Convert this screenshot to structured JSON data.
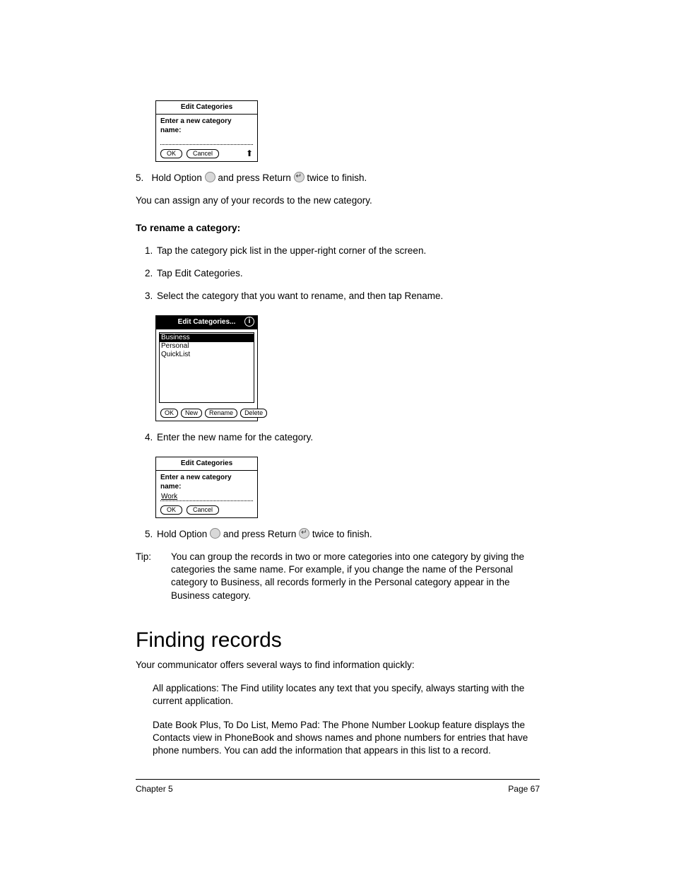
{
  "dialog1": {
    "title": "Edit Categories",
    "prompt": "Enter a new category name:",
    "input_value": "",
    "ok": "OK",
    "cancel": "Cancel"
  },
  "step5a": {
    "num": "5.",
    "pre": "Hold Option ",
    "mid": " and press Return ",
    "post": " twice to finish."
  },
  "assign_para": "You can assign any of your records to the new category.",
  "rename_head": "To rename a category:",
  "rename_steps": {
    "s1": "Tap the category pick list in the upper-right corner of the screen.",
    "s2": "Tap Edit Categories.",
    "s3": "Select the category that you want to rename, and then tap Rename."
  },
  "dialog2": {
    "title": "Edit Categories...",
    "items": [
      "Business",
      "Personal",
      "QuickList"
    ],
    "selected_index": 0,
    "ok": "OK",
    "new": "New",
    "rename": "Rename",
    "delete": "Delete"
  },
  "step4": "Enter the new name for the category.",
  "dialog3": {
    "title": "Edit Categories",
    "prompt": "Enter a new category name:",
    "input_value": "Work",
    "ok": "OK",
    "cancel": "Cancel"
  },
  "step5b": {
    "pre": "Hold Option ",
    "mid": " and press Return ",
    "post": " twice to finish."
  },
  "tip": {
    "label": "Tip:",
    "body": "You can group the records in two or more categories into one category by giving the categories the same name. For example, if you change the name of the Personal category to Business, all records formerly in the Personal category appear in the Business category."
  },
  "section": {
    "title": "Finding records",
    "intro": "Your communicator offers several ways to find information quickly:",
    "b1": "All applications: The Find utility locates any text that you specify, always starting with the current application.",
    "b2": "Date Book Plus, To Do List, Memo Pad: The Phone Number Lookup feature displays the Contacts view in PhoneBook and shows names and phone numbers for entries that have phone numbers. You can add the information that appears in this list to a record."
  },
  "footer": {
    "left": "Chapter 5",
    "right": "Page 67"
  }
}
